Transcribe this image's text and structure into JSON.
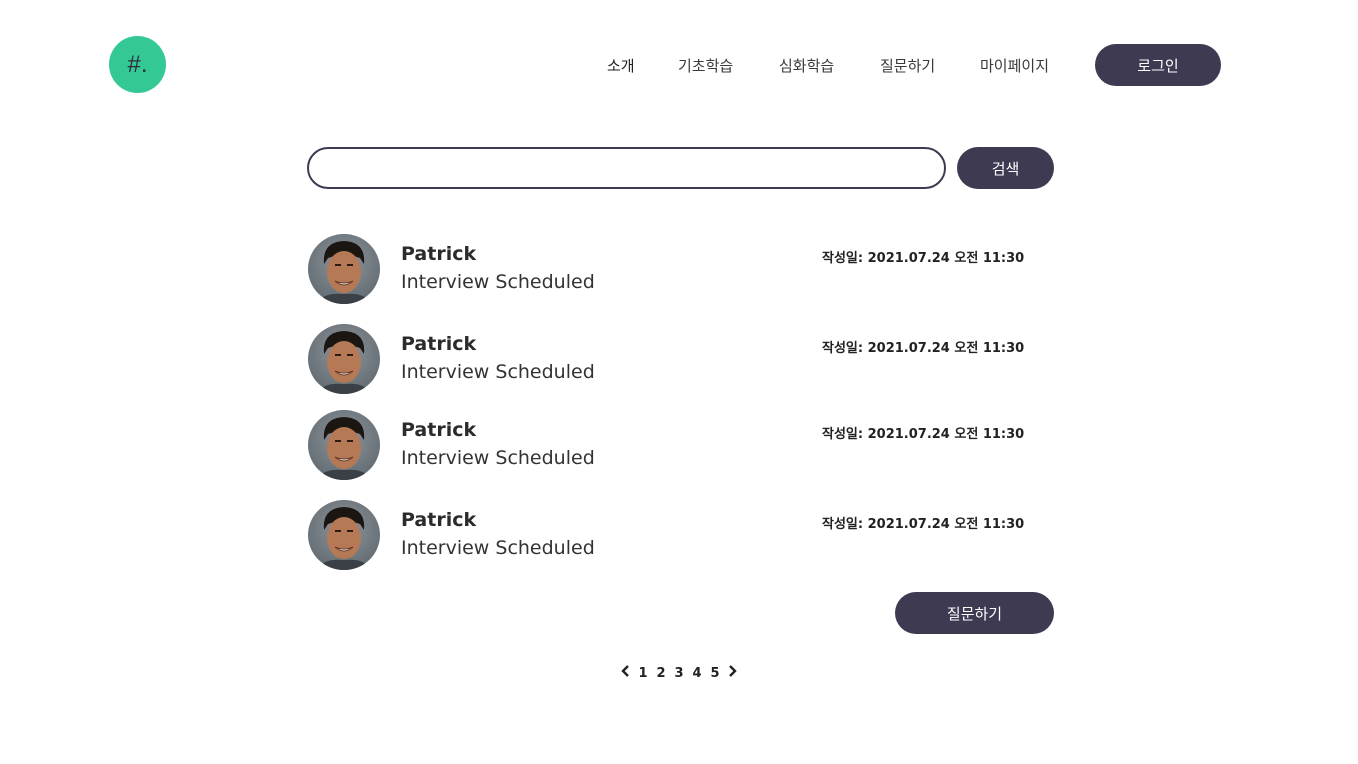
{
  "colors": {
    "brand": "#34c994",
    "dark": "#3d3a52"
  },
  "logo": {
    "text": "#."
  },
  "nav": {
    "items": [
      {
        "label": "소개"
      },
      {
        "label": "기초학습"
      },
      {
        "label": "심화학습"
      },
      {
        "label": "질문하기"
      },
      {
        "label": "마이페이지"
      }
    ],
    "login_label": "로그인"
  },
  "search": {
    "value": "",
    "placeholder": "",
    "button_label": "검색"
  },
  "posts": [
    {
      "author": "Patrick",
      "title": "Interview Scheduled",
      "date": "작성일: 2021.07.24 오전 11:30",
      "avatar_icon": "person-avatar"
    },
    {
      "author": "Patrick",
      "title": "Interview Scheduled",
      "date": "작성일: 2021.07.24 오전 11:30",
      "avatar_icon": "person-avatar"
    },
    {
      "author": "Patrick",
      "title": "Interview Scheduled",
      "date": "작성일: 2021.07.24 오전 11:30",
      "avatar_icon": "person-avatar"
    },
    {
      "author": "Patrick",
      "title": "Interview Scheduled",
      "date": "작성일: 2021.07.24 오전 11:30",
      "avatar_icon": "person-avatar"
    }
  ],
  "ask_button_label": "질문하기",
  "pagination": {
    "prev_icon": "chevron-left-icon",
    "next_icon": "chevron-right-icon",
    "pages": [
      "1",
      "2",
      "3",
      "4",
      "5"
    ]
  }
}
